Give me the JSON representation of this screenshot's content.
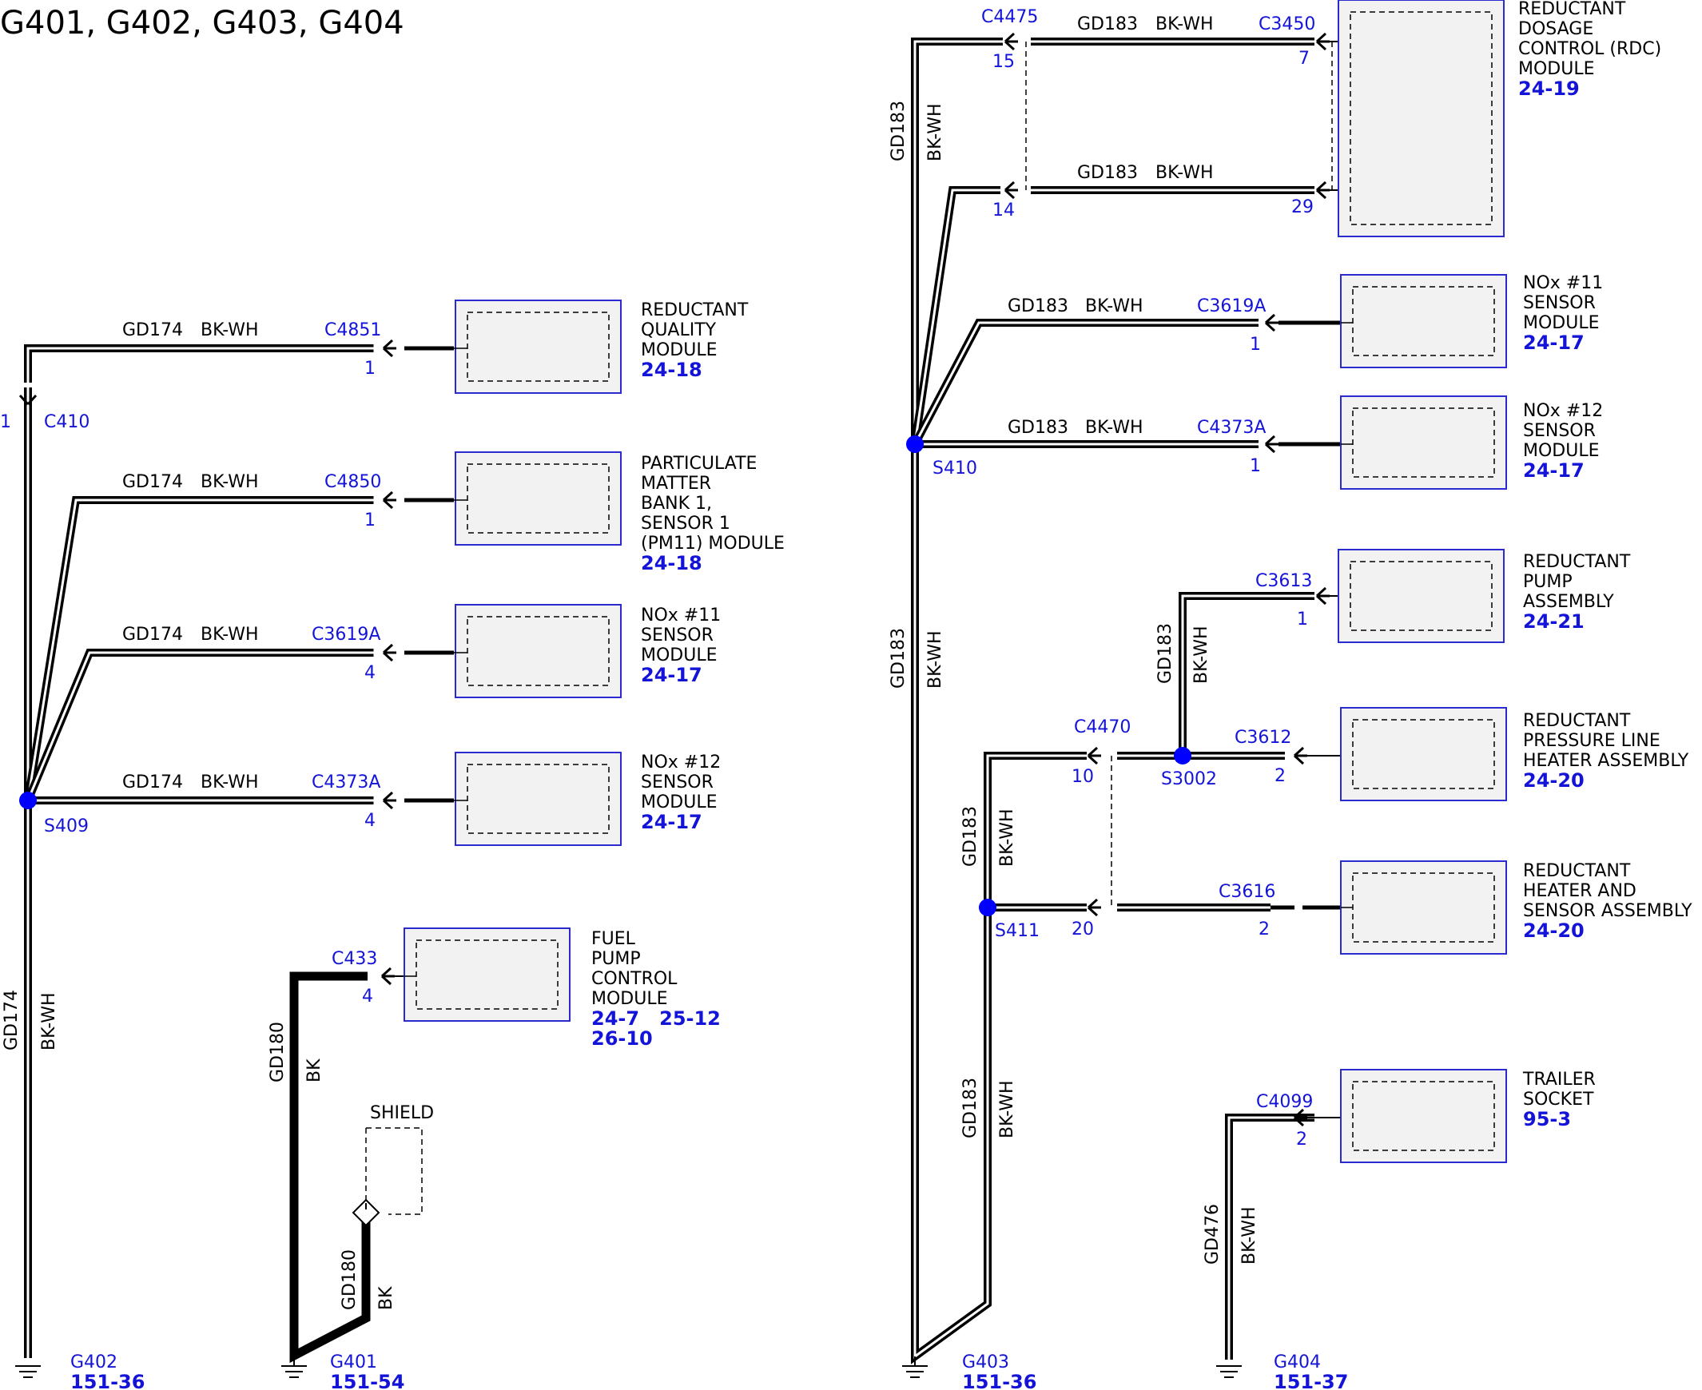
{
  "title": "G401, G402, G403, G404",
  "colors": {
    "connector": "#1414d8",
    "splice": "#0000ff",
    "box_stroke": "#2a2ad0",
    "box_fill": "#f2f2f2",
    "wire": "#000000"
  },
  "wire_labels": {
    "gd174": "GD174",
    "gd180": "GD180",
    "gd183": "GD183",
    "gd476": "GD476",
    "bk_wh": "BK-WH",
    "bk": "BK"
  },
  "connectors": {
    "c4851": "C4851",
    "c4850": "C4850",
    "c3619a": "C3619A",
    "c4373a": "C4373A",
    "c410": "C410",
    "c433": "C433",
    "c4475": "C4475",
    "c3450": "C3450",
    "c3613": "C3613",
    "c4470": "C4470",
    "c3612": "C3612",
    "c3616": "C3616",
    "c4099": "C4099"
  },
  "pins": {
    "p1": "1",
    "p2": "2",
    "p4": "4",
    "p7": "7",
    "p10": "10",
    "p14": "14",
    "p15": "15",
    "p20": "20",
    "p29": "29"
  },
  "splices": {
    "s409": "S409",
    "s410": "S410",
    "s411": "S411",
    "s3002": "S3002"
  },
  "shield": "SHIELD",
  "components": {
    "reductant_quality": {
      "lines": [
        "REDUCTANT",
        "QUALITY",
        "MODULE"
      ],
      "ref": "24-18"
    },
    "particulate_matter": {
      "lines": [
        "PARTICULATE",
        "MATTER",
        "BANK 1,",
        "SENSOR 1",
        "(PM11) MODULE"
      ],
      "ref": "24-18"
    },
    "nox11_left": {
      "lines": [
        "NOx #11",
        "SENSOR",
        "MODULE"
      ],
      "ref": "24-17"
    },
    "nox12_left": {
      "lines": [
        "NOx #12",
        "SENSOR",
        "MODULE"
      ],
      "ref": "24-17"
    },
    "fuel_pump": {
      "lines": [
        "FUEL",
        "PUMP",
        "CONTROL",
        "MODULE"
      ],
      "ref": "24-7   25-12",
      "ref2": "26-10"
    },
    "rdc": {
      "lines": [
        "REDUCTANT",
        "DOSAGE",
        "CONTROL (RDC)",
        "MODULE"
      ],
      "ref": "24-19"
    },
    "nox11_right": {
      "lines": [
        "NOx #11",
        "SENSOR",
        "MODULE"
      ],
      "ref": "24-17"
    },
    "nox12_right": {
      "lines": [
        "NOx #12",
        "SENSOR",
        "MODULE"
      ],
      "ref": "24-17"
    },
    "pump_assembly": {
      "lines": [
        "REDUCTANT",
        "PUMP",
        "ASSEMBLY"
      ],
      "ref": "24-21"
    },
    "pressure_line": {
      "lines": [
        "REDUCTANT",
        "PRESSURE LINE",
        "HEATER ASSEMBLY"
      ],
      "ref": "24-20"
    },
    "heater_sensor": {
      "lines": [
        "REDUCTANT",
        "HEATER AND",
        "SENSOR ASSEMBLY"
      ],
      "ref": "24-20"
    },
    "trailer_socket": {
      "lines": [
        "TRAILER",
        "SOCKET"
      ],
      "ref": "95-3"
    }
  },
  "grounds": {
    "g402": {
      "name": "G402",
      "ref": "151-36"
    },
    "g401": {
      "name": "G401",
      "ref": "151-54"
    },
    "g403": {
      "name": "G403",
      "ref": "151-36"
    },
    "g404": {
      "name": "G404",
      "ref": "151-37"
    }
  }
}
